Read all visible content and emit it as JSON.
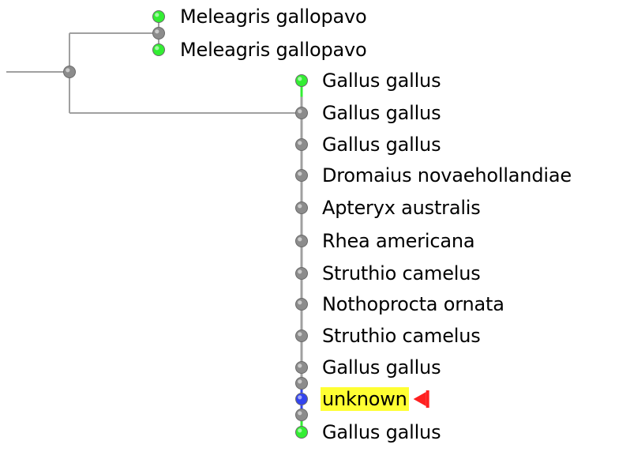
{
  "tree": {
    "colors": {
      "branch": "#a0a0a0",
      "node_gray": "#8c8c8c",
      "node_green": "#33ee33",
      "node_blue": "#3344ee",
      "highlight_bg": "#ffff33",
      "marker_red": "#ff2020"
    },
    "leaves": [
      {
        "label": "Meleagris gallopavo",
        "dot": "green",
        "highlight": false,
        "marker": ""
      },
      {
        "label": "Meleagris gallopavo",
        "dot": "green",
        "highlight": false,
        "marker": ""
      },
      {
        "label": "Gallus gallus",
        "dot": "green",
        "highlight": false,
        "marker": ""
      },
      {
        "label": "Gallus gallus",
        "dot": "gray",
        "highlight": false,
        "marker": ""
      },
      {
        "label": "Gallus gallus",
        "dot": "gray",
        "highlight": false,
        "marker": ""
      },
      {
        "label": "Dromaius novaehollandiae",
        "dot": "gray",
        "highlight": false,
        "marker": ""
      },
      {
        "label": "Apteryx australis",
        "dot": "gray",
        "highlight": false,
        "marker": ""
      },
      {
        "label": "Rhea americana",
        "dot": "gray",
        "highlight": false,
        "marker": ""
      },
      {
        "label": "Struthio camelus",
        "dot": "gray",
        "highlight": false,
        "marker": ""
      },
      {
        "label": "Nothoprocta ornata",
        "dot": "gray",
        "highlight": false,
        "marker": ""
      },
      {
        "label": "Struthio camelus",
        "dot": "gray",
        "highlight": false,
        "marker": ""
      },
      {
        "label": "Gallus gallus",
        "dot": "gray",
        "highlight": false,
        "marker": ""
      },
      {
        "label": "unknown",
        "dot": "blue",
        "highlight": true,
        "marker": "red-flag-icon"
      },
      {
        "label": "Gallus gallus",
        "dot": "green",
        "highlight": false,
        "marker": ""
      }
    ]
  }
}
